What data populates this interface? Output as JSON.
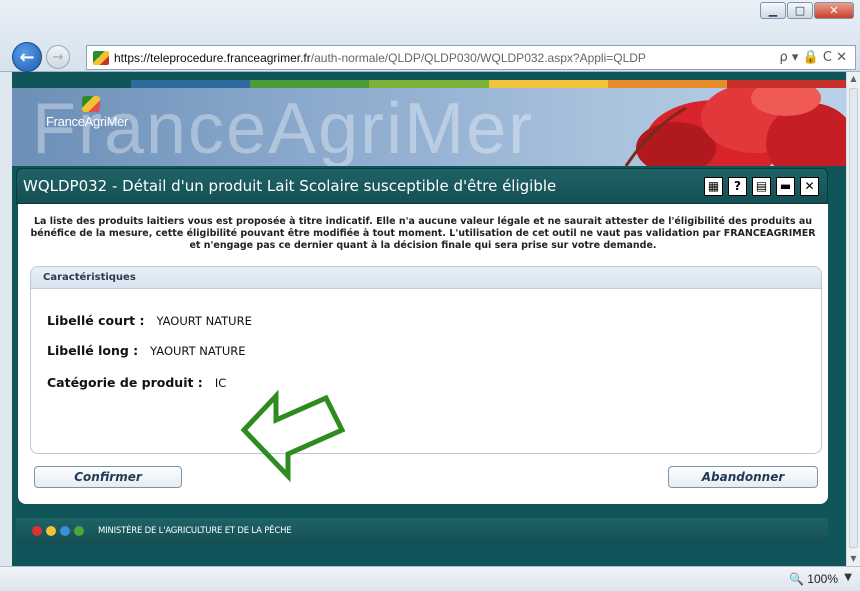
{
  "browser": {
    "url_host": "https://teleprocedure.franceagrimer.fr",
    "url_path": "/auth-normale/QLDP/QLDP030/WQLDP032.aspx?Appli=QLDP",
    "zoom": "100%",
    "address_tools": "ρ ▾ 🔒 C ✕"
  },
  "banner": {
    "watermark": "FranceAgriMer",
    "logo_text": "FranceAgriMer",
    "stripe_colors": [
      "#0f5559",
      "#2e6b9e",
      "#4a9c3a",
      "#7bb23a",
      "#f2c23a",
      "#e88b2a",
      "#c7312a"
    ]
  },
  "page": {
    "title": "WQLDP032 - Détail d'un produit Lait Scolaire susceptible d'être éligible",
    "disclaimer": "La liste des produits laitiers vous est proposée à titre indicatif. Elle n'a aucune valeur légale et ne saurait attester de l'éligibilité des produits au bénéfice de la mesure, cette éligibilité pouvant être modifiée à tout moment. L'utilisation de cet outil ne vaut pas validation par FRANCEAGRIMER et n'engage pas ce dernier quant à la décision finale qui sera prise sur votre demande.",
    "section_title": "Caractéristiques",
    "fields": [
      {
        "label": "Libellé court :",
        "value": "YAOURT NATURE"
      },
      {
        "label": "Libellé long :",
        "value": "YAOURT NATURE"
      },
      {
        "label": "Catégorie de produit :",
        "value": "IC"
      }
    ],
    "confirm_label": "Confirmer",
    "abandon_label": "Abandonner",
    "title_icons": [
      "calculator-icon",
      "help-icon",
      "print-icon",
      "minimize-icon",
      "close-icon"
    ],
    "title_icon_glyphs": [
      "▦",
      "?",
      "▤",
      "▬",
      "✕"
    ]
  },
  "footer": {
    "ministry": "MINISTÈRE DE L'AGRICULTURE ET DE LA PÊCHE",
    "dot_colors": [
      "#e03030",
      "#f2c23a",
      "#3c8ed6",
      "#4aa83a"
    ]
  },
  "annotation": {
    "arrow_color": "#2e8b1e"
  }
}
